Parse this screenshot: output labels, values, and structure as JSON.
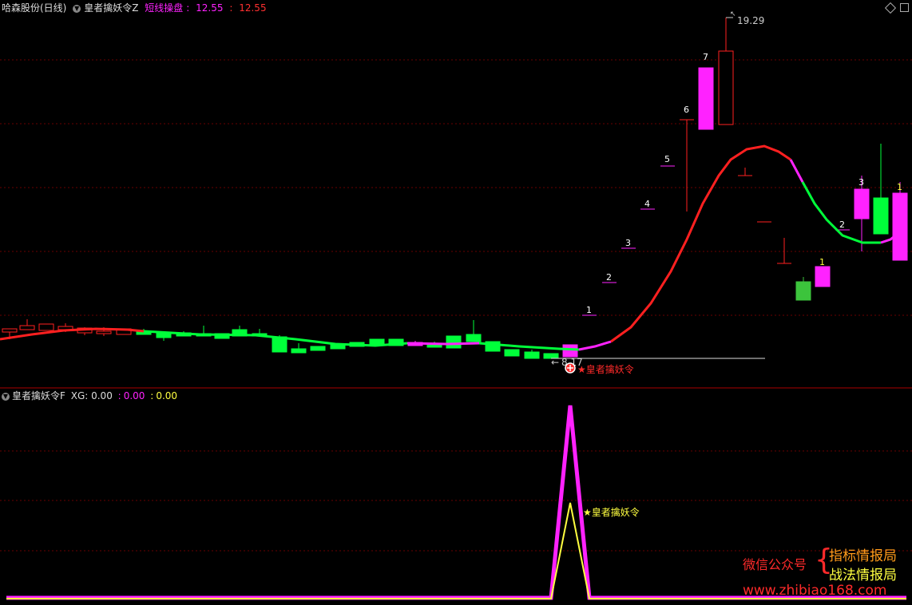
{
  "main_panel": {
    "stock_title": "哈森股份(日线)",
    "indicator_name": "皇者擒妖令Z",
    "line_label": "短线操盘",
    "value1": "12.55",
    "value2": "12.55",
    "high_label": "19.29",
    "low_label": "8.17",
    "signal_label": "★皇者擒妖令",
    "count_labels_up": [
      "1",
      "2",
      "3",
      "4",
      "5",
      "6",
      "7"
    ],
    "count_labels_down": [
      "1",
      "2",
      "3",
      "1"
    ]
  },
  "sub_panel": {
    "indicator_name": "皇者擒妖令F",
    "xg_label": "XG: 0.00",
    "value2": "0.00",
    "value3": "0.00",
    "signal_label": "★皇者擒妖令"
  },
  "watermark": {
    "wechat": "微信公众号",
    "name1": "指标情报局",
    "name2": "战法情报局",
    "url": "www.zhibiao168.com"
  },
  "colors": {
    "red": "#ff2020",
    "green": "#00ff3a",
    "magenta": "#ff22ff",
    "yellow": "#ffff40",
    "grid": "#5a0000"
  },
  "chart_data": {
    "type": "candlestick",
    "high": 19.29,
    "low": 8.17,
    "last": 12.55,
    "sub_series": [
      {
        "name": "XG",
        "peak": 1,
        "base": 0
      }
    ]
  }
}
